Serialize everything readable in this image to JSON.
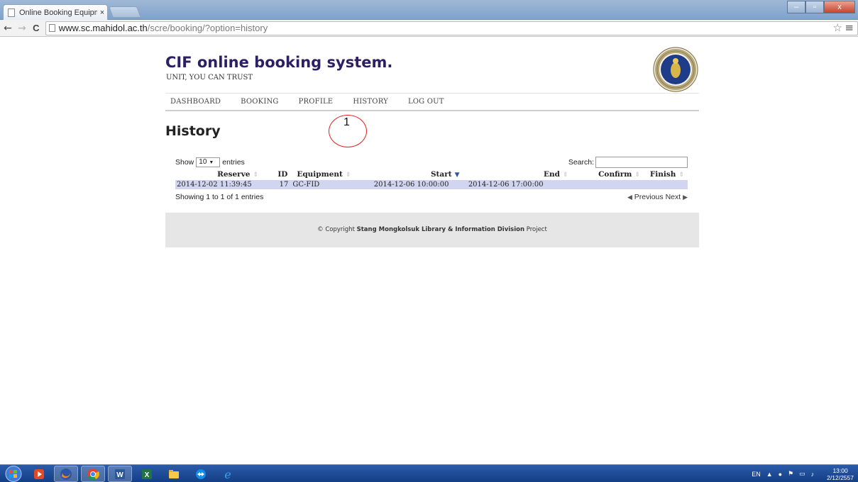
{
  "browser": {
    "tab_title": "Online Booking Equipmer",
    "tab_close": "×",
    "url_host": "www.sc.mahidol.ac.th",
    "url_path": "/scre/booking/?option=history",
    "win_minimize": "–",
    "win_maximize": "▫",
    "win_close": "x",
    "back": "←",
    "forward": "→",
    "reload": "C",
    "bookmark": "☆",
    "menu": "≡"
  },
  "site": {
    "title": "CIF online booking system.",
    "tagline": "UNIT, YOU CAN TRUST"
  },
  "nav": [
    {
      "label": "DASHBOARD"
    },
    {
      "label": "BOOKING"
    },
    {
      "label": "PROFILE"
    },
    {
      "label": "HISTORY"
    },
    {
      "label": "LOG OUT"
    }
  ],
  "page_heading": "History",
  "annotation": {
    "number": "1"
  },
  "table": {
    "show_label": "Show",
    "entries_label": "entries",
    "page_size": "10",
    "search_label": "Search:",
    "search_value": "",
    "columns": [
      {
        "label": "Reserve"
      },
      {
        "label": "ID"
      },
      {
        "label": "Equipment"
      },
      {
        "label": "Start"
      },
      {
        "label": "End"
      },
      {
        "label": "Confirm"
      },
      {
        "label": "Finish"
      }
    ],
    "rows": [
      {
        "reserve": "2014-12-02 11:39:45",
        "id": "17",
        "equipment": "GC-FID",
        "start": "2014-12-06 10:00:00",
        "end": "2014-12-06 17:00:00",
        "confirm": "",
        "finish": ""
      }
    ],
    "info": "Showing 1 to 1 of 1 entries",
    "previous": "Previous",
    "next": "Next"
  },
  "footer": {
    "copyright": "© Copyright",
    "org": "Stang Mongkolsuk Library & Information Division",
    "suffix": "Project"
  },
  "taskbar": {
    "lang": "EN",
    "time": "13:00",
    "date": "2/12/2557"
  }
}
